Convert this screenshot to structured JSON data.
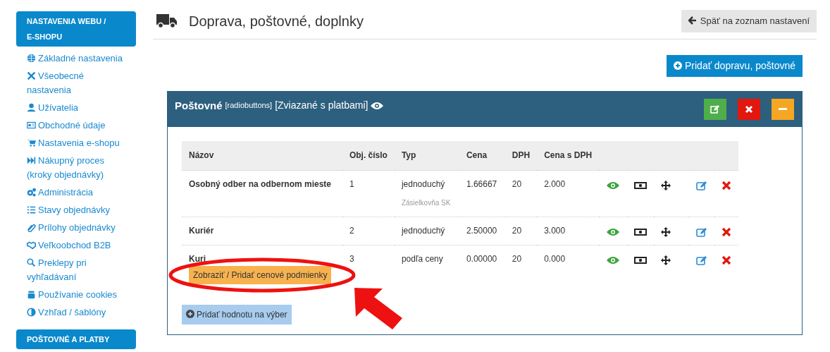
{
  "sidebar": {
    "sections": [
      {
        "title": "NASTAVENIA WEBU / E-SHOPU",
        "items": [
          {
            "label": "Základné nastavenia"
          },
          {
            "label": "Všeobecné nastavenia"
          },
          {
            "label": "Užívatelia"
          },
          {
            "label": "Obchodné údaje"
          },
          {
            "label": "Nastavenia e-shopu"
          },
          {
            "label": "Nákupný proces (kroky objednávky)"
          },
          {
            "label": "Administrácia"
          },
          {
            "label": "Stavy objednávky"
          },
          {
            "label": "Prílohy objednávky"
          },
          {
            "label": "Veľkoobchod B2B"
          },
          {
            "label": "Preklepy pri vyhľadávaní"
          },
          {
            "label": "Používanie cookies"
          },
          {
            "label": "Vzhľad / šablóny"
          }
        ]
      },
      {
        "title": "POŠTOVNÉ A PLATBY"
      }
    ]
  },
  "page": {
    "title": "Doprava, poštovné, doplnky",
    "back_button": "Späť na zoznam nastavení",
    "add_button": "Pridať dopravu, poštovné"
  },
  "panel": {
    "title": "Poštovné",
    "type_note": "[radiobuttons]",
    "link_note": "[Zviazané s platbami]",
    "table": {
      "columns": [
        "Názov",
        "Obj. číslo",
        "Typ",
        "Cena",
        "DPH",
        "Cena s DPH"
      ],
      "rows": [
        {
          "name": "Osobný odber na odbernom mieste",
          "number": "1",
          "type": "jednoduchý",
          "type_note": "Zásielkovňa SK",
          "price": "1.66667",
          "vat": "20",
          "price_vat": "2.000"
        },
        {
          "name": "Kuriér",
          "number": "2",
          "type": "jednoduchý",
          "price": "2.50000",
          "vat": "20",
          "price_vat": "3.000"
        },
        {
          "name": "Kuri",
          "number": "3",
          "type": "podľa ceny",
          "price": "0.00000",
          "vat": "20",
          "price_vat": "0.000",
          "conditions_button": "Zobraziť / Pridať cenové podmienky"
        }
      ]
    },
    "add_value_button": "Pridať hodnotu na výber"
  }
}
